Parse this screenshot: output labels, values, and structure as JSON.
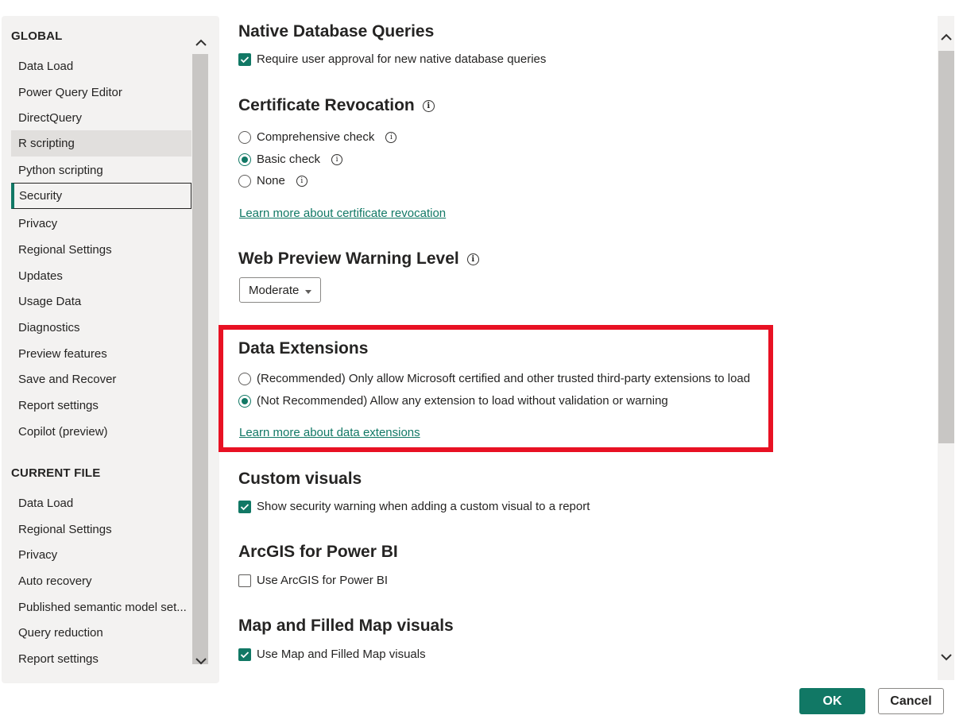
{
  "sidebar": {
    "global_header": "GLOBAL",
    "global_items": [
      {
        "label": "Data Load"
      },
      {
        "label": "Power Query Editor"
      },
      {
        "label": "DirectQuery"
      },
      {
        "label": "R scripting"
      },
      {
        "label": "Python scripting"
      },
      {
        "label": "Security"
      },
      {
        "label": "Privacy"
      },
      {
        "label": "Regional Settings"
      },
      {
        "label": "Updates"
      },
      {
        "label": "Usage Data"
      },
      {
        "label": "Diagnostics"
      },
      {
        "label": "Preview features"
      },
      {
        "label": "Save and Recover"
      },
      {
        "label": "Report settings"
      },
      {
        "label": "Copilot (preview)"
      }
    ],
    "current_header": "CURRENT FILE",
    "current_items": [
      {
        "label": "Data Load"
      },
      {
        "label": "Regional Settings"
      },
      {
        "label": "Privacy"
      },
      {
        "label": "Auto recovery"
      },
      {
        "label": "Published semantic model set..."
      },
      {
        "label": "Query reduction"
      },
      {
        "label": "Report settings"
      }
    ],
    "selected": "Security",
    "hovered": "R scripting"
  },
  "main": {
    "native_db": {
      "title": "Native Database Queries",
      "option": "Require user approval for new native database queries",
      "checked": true
    },
    "cert": {
      "title": "Certificate Revocation",
      "options": [
        {
          "label": "Comprehensive check",
          "selected": false
        },
        {
          "label": "Basic check",
          "selected": true
        },
        {
          "label": "None",
          "selected": false
        }
      ],
      "link": "Learn more about certificate revocation"
    },
    "web_preview": {
      "title": "Web Preview Warning Level",
      "value": "Moderate"
    },
    "data_ext": {
      "title": "Data Extensions",
      "options": [
        {
          "label": "(Recommended) Only allow Microsoft certified and other trusted third-party extensions to load",
          "selected": false
        },
        {
          "label": "(Not Recommended) Allow any extension to load without validation or warning",
          "selected": true
        }
      ],
      "link": "Learn more about data extensions"
    },
    "custom_visuals": {
      "title": "Custom visuals",
      "option": "Show security warning when adding a custom visual to a report",
      "checked": true
    },
    "arcgis": {
      "title": "ArcGIS for Power BI",
      "option": "Use ArcGIS for Power BI",
      "checked": false
    },
    "map": {
      "title": "Map and Filled Map visuals",
      "option": "Use Map and Filled Map visuals",
      "checked": true
    }
  },
  "footer": {
    "ok": "OK",
    "cancel": "Cancel"
  },
  "colors": {
    "accent": "#117865",
    "highlight": "#e81123"
  },
  "icons": {
    "info": "i",
    "checkmark": "check-icon",
    "chevron_up": "chevron-up-icon",
    "chevron_down": "chevron-down-icon",
    "dropdown_caret": "caret-down-icon"
  }
}
